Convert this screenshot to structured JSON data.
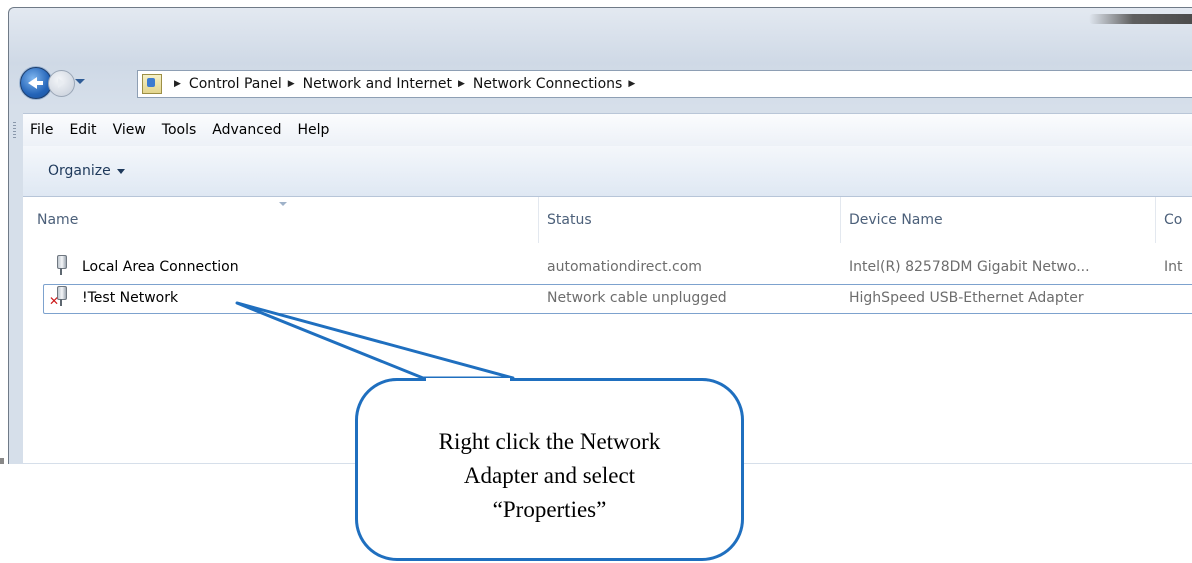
{
  "address_bar": {
    "crumbs": [
      "Control Panel",
      "Network and Internet",
      "Network Connections"
    ]
  },
  "menu": {
    "items": [
      "File",
      "Edit",
      "View",
      "Tools",
      "Advanced",
      "Help"
    ]
  },
  "command_bar": {
    "organize_label": "Organize"
  },
  "columns": {
    "name": "Name",
    "status": "Status",
    "device_name": "Device Name",
    "connectivity_partial": "Co"
  },
  "rows": [
    {
      "name": "Local Area Connection",
      "status": "automationdirect.com",
      "device": "Intel(R) 82578DM Gigabit Netwo...",
      "extra": "Int",
      "icon": "network-adapter-icon",
      "disconnected": false
    },
    {
      "name": "!Test Network",
      "status": "Network cable unplugged",
      "device": "HighSpeed USB-Ethernet Adapter",
      "extra": "",
      "icon": "network-adapter-disconnected-icon",
      "disconnected": true
    }
  ],
  "callout": {
    "text": "Right click the Network\nAdapter and select\n“Properties”",
    "border_color": "#1f6fbf"
  }
}
